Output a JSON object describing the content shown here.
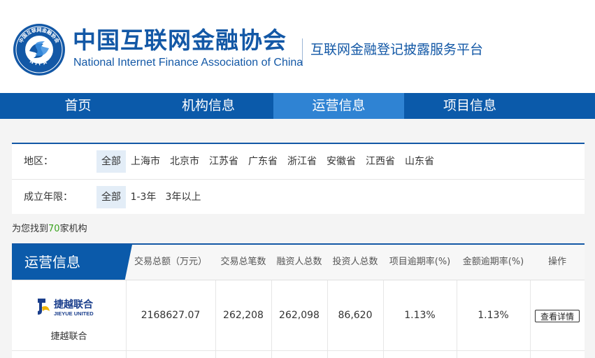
{
  "header": {
    "org_name_cn": "中国互联网金融协会",
    "org_name_en": "National Internet Finance Association of China",
    "emblem_text_top": "中国互联网金融协会",
    "emblem_text_bottom": "NIFA",
    "platform_title": "互联网金融登记披露服务平台",
    "brand_color": "#1358a6"
  },
  "nav": {
    "items": [
      {
        "label": "首页"
      },
      {
        "label": "机构信息"
      },
      {
        "label": "运营信息",
        "active": true
      },
      {
        "label": "项目信息"
      }
    ],
    "bg_color": "#0b5aaa",
    "active_color": "#2f83d3"
  },
  "filters": {
    "region": {
      "label": "地区：",
      "options": [
        "全部",
        "上海市",
        "北京市",
        "江苏省",
        "广东省",
        "浙江省",
        "安徽省",
        "江西省",
        "山东省"
      ],
      "selected": "全部"
    },
    "years": {
      "label": "成立年限：",
      "options": [
        "全部",
        "1-3年",
        "3年以上"
      ],
      "selected": "全部"
    }
  },
  "results": {
    "prefix": "为您找到",
    "count": "70",
    "suffix": "家机构",
    "count_color": "#3aa31f"
  },
  "table": {
    "title": "运营信息",
    "columns": [
      "交易总额（万元）",
      "交易总笔数",
      "融资人总数",
      "投资人总数",
      "项目逾期率(%)",
      "金额逾期率(%)",
      "操作"
    ],
    "rows": [
      {
        "logo_text_cn": "捷越联合",
        "logo_text_en": "JIEYUE UNITED",
        "name": "捷越联合",
        "total_amount": "2168627.07",
        "total_count": "262,208",
        "borrowers": "262,098",
        "investors": "86,620",
        "project_overdue": "1.13%",
        "amount_overdue": "1.13%",
        "action_label": "查看详情"
      }
    ]
  }
}
